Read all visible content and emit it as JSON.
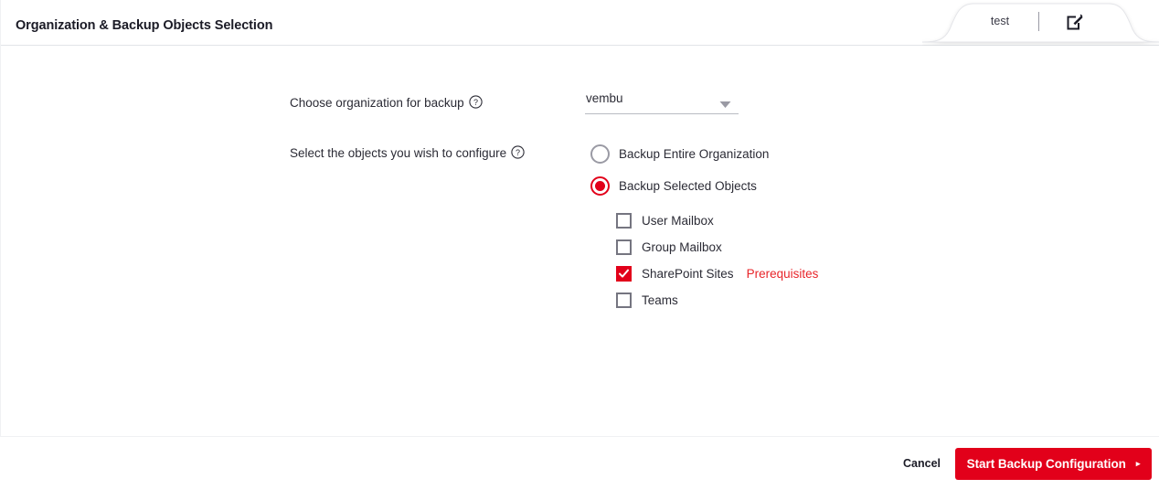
{
  "header": {
    "title": "Organization & Backup Objects Selection",
    "tab": {
      "label": "test",
      "edit_icon": "edit-square-pencil-icon"
    }
  },
  "form": {
    "organization": {
      "label": "Choose organization for backup",
      "help_icon": "help-circle-icon",
      "selected_value": "vembu",
      "caret_icon": "chevron-down-icon"
    },
    "objects": {
      "label": "Select the objects you wish to configure",
      "help_icon": "help-circle-icon",
      "radios": [
        {
          "label": "Backup Entire Organization",
          "selected": false
        },
        {
          "label": "Backup Selected Objects",
          "selected": true
        }
      ],
      "checkboxes": [
        {
          "label": "User Mailbox",
          "checked": false,
          "link": ""
        },
        {
          "label": "Group Mailbox",
          "checked": false,
          "link": ""
        },
        {
          "label": "SharePoint Sites",
          "checked": true,
          "link": "Prerequisites"
        },
        {
          "label": "Teams",
          "checked": false,
          "link": ""
        }
      ]
    }
  },
  "footer": {
    "cancel_label": "Cancel",
    "primary_label": "Start Backup Configuration",
    "primary_arrow": "▸"
  },
  "colors": {
    "accent_red": "#e2001a",
    "link_red": "#e8252a",
    "text": "#2b2b35",
    "border": "#e2e4e8"
  }
}
